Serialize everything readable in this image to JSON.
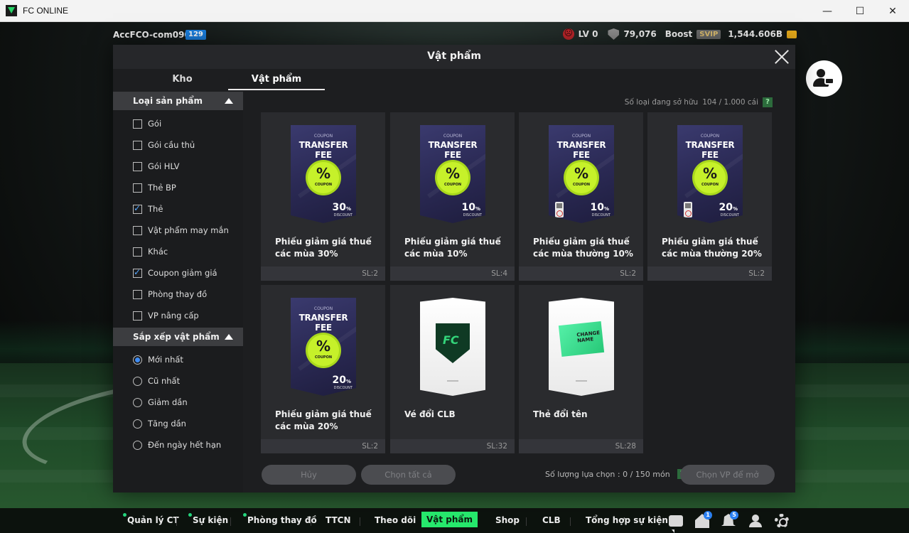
{
  "window": {
    "title": "FC ONLINE",
    "minimize": "—",
    "maximize": "☐",
    "close": "✕"
  },
  "status": {
    "account_name": "AccFCO-com0907b",
    "account_level": "129",
    "lv": "LV 0",
    "points": "79,076",
    "boost_label": "Boost",
    "svip": "SVIP",
    "coins": "1,544.606B"
  },
  "modal": {
    "title": "Vật phẩm",
    "tabs": [
      {
        "label": "Kho",
        "active": false
      },
      {
        "label": "Vật phẩm",
        "active": true
      }
    ]
  },
  "sidebar": {
    "category_header": "Loại sản phẩm",
    "categories": [
      {
        "label": "Gói",
        "checked": false
      },
      {
        "label": "Gói cầu thủ",
        "checked": false
      },
      {
        "label": "Gói HLV",
        "checked": false
      },
      {
        "label": "Thẻ BP",
        "checked": false
      },
      {
        "label": "Thẻ",
        "checked": true
      },
      {
        "label": "Vật phẩm may mắn",
        "checked": false
      },
      {
        "label": "Khác",
        "checked": false
      },
      {
        "label": "Coupon giảm giá",
        "checked": true
      },
      {
        "label": "Phòng thay đồ",
        "checked": false
      },
      {
        "label": "VP nâng cấp",
        "checked": false
      }
    ],
    "sort_header": "Sắp xếp vật phẩm",
    "sorts": [
      {
        "label": "Mới nhất",
        "selected": true
      },
      {
        "label": "Cũ nhất",
        "selected": false
      },
      {
        "label": "Giảm dần",
        "selected": false
      },
      {
        "label": "Tăng dần",
        "selected": false
      },
      {
        "label": "Đến ngày hết hạn",
        "selected": false
      }
    ]
  },
  "content": {
    "owned_label": "Số loại đang sở hữu",
    "owned_value": "104 / 1.000 cái",
    "help": "?",
    "items": [
      {
        "type": "coupon",
        "coupon_small": "COUPON",
        "coupon_title": "TRANSFER FEE",
        "seal_pct": "%",
        "seal_label": "COUPON",
        "discount": "30",
        "discount_unit": "%",
        "discount_label": "DISCOUNT",
        "locked": false,
        "name": "Phiếu giảm giá thuế các mùa 30%",
        "qty": "SL:2"
      },
      {
        "type": "coupon",
        "coupon_small": "COUPON",
        "coupon_title": "TRANSFER FEE",
        "seal_pct": "%",
        "seal_label": "COUPON",
        "discount": "10",
        "discount_unit": "%",
        "discount_label": "DISCOUNT",
        "locked": false,
        "name": "Phiếu giảm giá thuế các mùa 10%",
        "qty": "SL:4"
      },
      {
        "type": "coupon",
        "coupon_small": "COUPON",
        "coupon_title": "TRANSFER FEE",
        "seal_pct": "%",
        "seal_label": "COUPON",
        "discount": "10",
        "discount_unit": "%",
        "discount_label": "DISCOUNT",
        "locked": true,
        "name": "Phiếu giảm giá thuế các mùa thường 10%",
        "qty": "SL:2"
      },
      {
        "type": "coupon",
        "coupon_small": "COUPON",
        "coupon_title": "TRANSFER FEE",
        "seal_pct": "%",
        "seal_label": "COUPON",
        "discount": "20",
        "discount_unit": "%",
        "discount_label": "DISCOUNT",
        "locked": true,
        "name": "Phiếu giảm giá thuế các mùa thường 20%",
        "qty": "SL:2"
      },
      {
        "type": "coupon",
        "coupon_small": "COUPON",
        "coupon_title": "TRANSFER FEE",
        "seal_pct": "%",
        "seal_label": "COUPON",
        "discount": "20",
        "discount_unit": "%",
        "discount_label": "DISCOUNT",
        "locked": false,
        "name": "Phiếu giảm giá thuế các mùa 20%",
        "qty": "SL:2"
      },
      {
        "type": "club-ticket",
        "name": "Vé đổi CLB",
        "qty": "SL:32"
      },
      {
        "type": "name-card",
        "tag_text": "CHANGE NAME",
        "name": "Thẻ đổi tên",
        "qty": "SL:28"
      }
    ],
    "cancel_label": "Hủy",
    "select_all_label": "Chọn tất cả",
    "selection_label": "Số lượng lựa chọn : 0 / 150 món",
    "open_label": "Chọn VP để mở"
  },
  "bottom_nav": {
    "items": [
      {
        "label": "Quản lý CT",
        "dot": true
      },
      {
        "label": "Sự kiện",
        "dot": true
      },
      {
        "label": "Phòng thay đồ",
        "dot": true
      },
      {
        "label": "TTCN",
        "dot": false
      },
      {
        "label": "Theo dõi",
        "dot": false
      },
      {
        "label": "Vật phẩm",
        "dot": false,
        "active": true
      },
      {
        "label": "Shop",
        "dot": false
      },
      {
        "label": "CLB",
        "dot": false
      },
      {
        "label": "Tổng hợp sự kiện",
        "dot": false
      }
    ],
    "home_badge": "1",
    "bell_badge": "5"
  },
  "colors": {
    "accent_green": "#26e86c",
    "checkbox_blue": "#56a8ff",
    "coupon_seal": "#c6f12a"
  }
}
